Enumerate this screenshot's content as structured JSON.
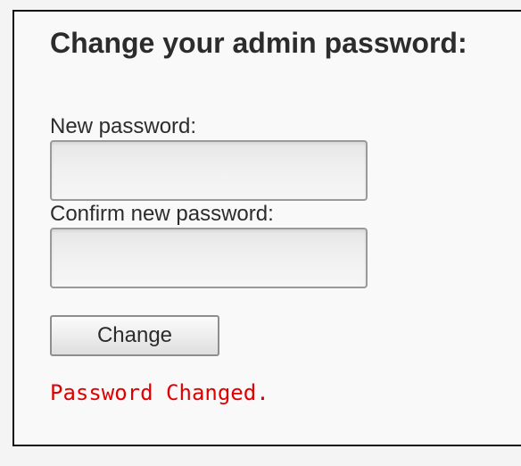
{
  "form": {
    "title": "Change your admin password:",
    "new_password_label": "New password:",
    "new_password_value": "",
    "confirm_password_label": "Confirm new password:",
    "confirm_password_value": "",
    "submit_label": "Change",
    "status_message": "Password Changed."
  },
  "colors": {
    "status_text": "#e00000",
    "panel_border": "#111111",
    "panel_background": "#f8f9f8"
  }
}
